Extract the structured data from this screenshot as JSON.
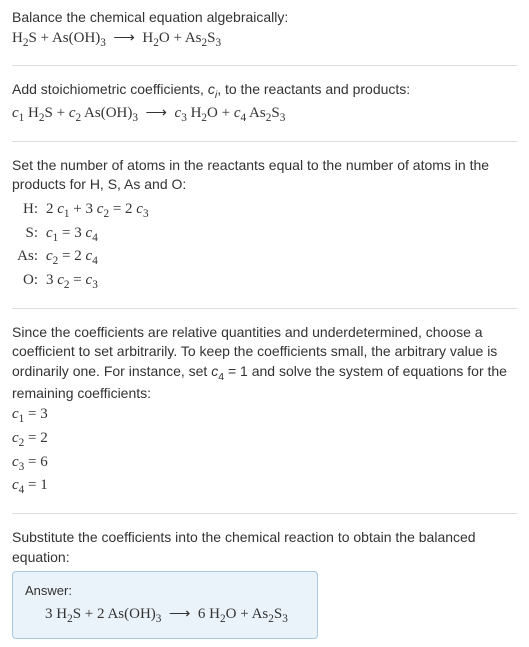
{
  "section1": {
    "heading": "Balance the chemical equation algebraically:",
    "equation_html": "H<sub>2</sub>S + As(OH)<sub>3</sub>&nbsp;&nbsp;⟶&nbsp;&nbsp;H<sub>2</sub>O + As<sub>2</sub>S<sub>3</sub>"
  },
  "section2": {
    "heading_html": "Add stoichiometric coefficients, <span class='italic'>c<sub>i</sub></span>, to the reactants and products:",
    "equation_html": "<span class='italic'>c</span><sub>1</sub> H<sub>2</sub>S + <span class='italic'>c</span><sub>2</sub> As(OH)<sub>3</sub>&nbsp;&nbsp;⟶&nbsp;&nbsp;<span class='italic'>c</span><sub>3</sub> H<sub>2</sub>O + <span class='italic'>c</span><sub>4</sub> As<sub>2</sub>S<sub>3</sub>"
  },
  "section3": {
    "heading": "Set the number of atoms in the reactants equal to the number of atoms in the products for H, S, As and O:",
    "rows": [
      {
        "label": "H:",
        "eq_html": "2 <span class='italic'>c</span><sub>1</sub> + 3 <span class='italic'>c</span><sub>2</sub> = 2 <span class='italic'>c</span><sub>3</sub>"
      },
      {
        "label": "S:",
        "eq_html": "<span class='italic'>c</span><sub>1</sub> = 3 <span class='italic'>c</span><sub>4</sub>"
      },
      {
        "label": "As:",
        "eq_html": "<span class='italic'>c</span><sub>2</sub> = 2 <span class='italic'>c</span><sub>4</sub>"
      },
      {
        "label": "O:",
        "eq_html": "3 <span class='italic'>c</span><sub>2</sub> = <span class='italic'>c</span><sub>3</sub>"
      }
    ]
  },
  "section4": {
    "heading_html": "Since the coefficients are relative quantities and underdetermined, choose a coefficient to set arbitrarily. To keep the coefficients small, the arbitrary value is ordinarily one. For instance, set <span class='italic'>c</span><sub>4</sub> = 1 and solve the system of equations for the remaining coefficients:",
    "lines": [
      "<span class='italic'>c</span><sub>1</sub> = 3",
      "<span class='italic'>c</span><sub>2</sub> = 2",
      "<span class='italic'>c</span><sub>3</sub> = 6",
      "<span class='italic'>c</span><sub>4</sub> = 1"
    ]
  },
  "section5": {
    "heading": "Substitute the coefficients into the chemical reaction to obtain the balanced equation:",
    "answer_label": "Answer:",
    "answer_html": "3 H<sub>2</sub>S + 2 As(OH)<sub>3</sub>&nbsp;&nbsp;⟶&nbsp;&nbsp;6 H<sub>2</sub>O + As<sub>2</sub>S<sub>3</sub>"
  }
}
